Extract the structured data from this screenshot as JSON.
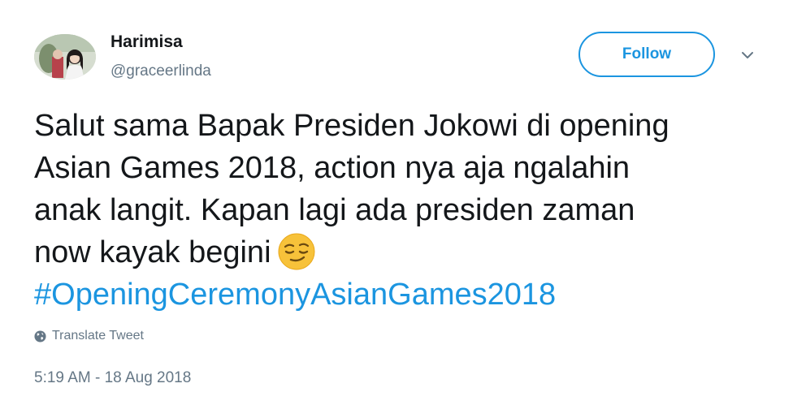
{
  "user": {
    "display_name": "Harimisa",
    "handle": "@graceerlinda"
  },
  "actions": {
    "follow_label": "Follow",
    "menu_icon": "chevron-down-icon"
  },
  "tweet": {
    "lines": [
      "Salut sama Bapak Presiden Jokowi di opening",
      "Asian Games 2018, action nya aja ngalahin",
      "anak langit. Kapan lagi ada presiden zaman",
      "now kayak begini"
    ],
    "emoji": "smirking-face-emoji",
    "hashtag": "#OpeningCeremonyAsianGames2018"
  },
  "translate": {
    "label": "Translate Tweet",
    "icon": "globe-icon"
  },
  "timestamp": "5:19 AM - 18 Aug 2018",
  "colors": {
    "accent": "#1b95e0",
    "muted": "#657786",
    "text": "#14171a"
  }
}
